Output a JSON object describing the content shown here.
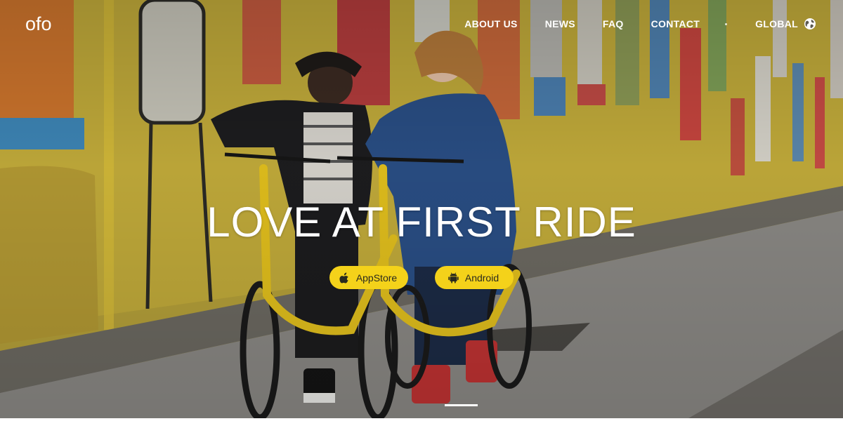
{
  "header": {
    "logo_text": "ofo",
    "nav": {
      "about": "ABOUT US",
      "news": "NEWS",
      "faq": "FAQ",
      "contact": "CONTACT",
      "global": "GLOBAL"
    }
  },
  "hero": {
    "headline": "LOVE AT FIRST RIDE",
    "buttons": {
      "appstore": "AppStore",
      "android": "Android"
    },
    "slides": {
      "current": 1
    }
  },
  "icons": {
    "globe": "globe-icon",
    "apple": "apple-icon",
    "android": "android-icon"
  },
  "colors": {
    "brand_yellow": "#f4d21a",
    "nav_text": "#ffffff",
    "button_text": "#2a2a1e"
  }
}
